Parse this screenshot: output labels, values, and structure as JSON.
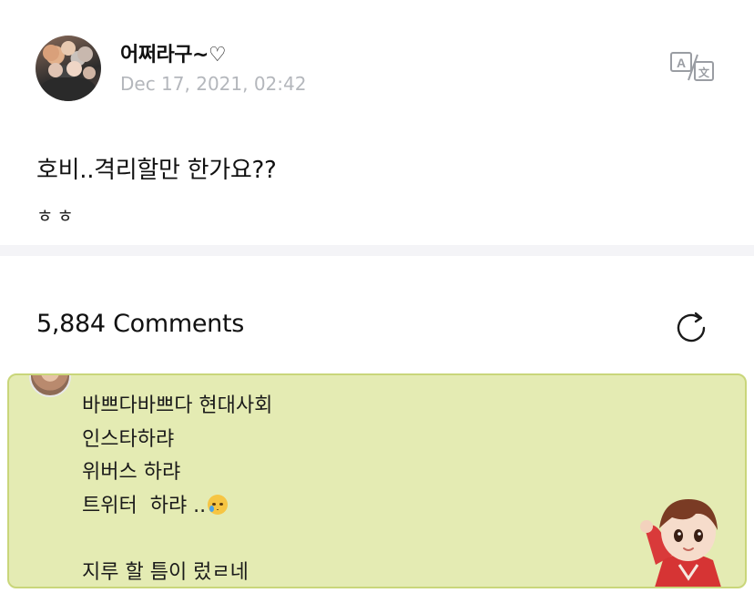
{
  "post": {
    "author": "어쩌라구~♡",
    "date": "Dec 17, 2021, 02:42",
    "title": "호비..격리할만 한가요??",
    "subtitle": "ㅎㅎ"
  },
  "comments": {
    "count_label": "5,884 Comments"
  },
  "comment": {
    "lines": [
      "바쁘다바쁘다 현대사회",
      "인스타하랴",
      "위버스 하랴",
      "트위터  하랴 ..",
      "",
      "지루 할 틈이 렀ㄹ네"
    ],
    "emoji": "crying-face-emoji",
    "sticker": "character-sticker"
  },
  "icons": {
    "translate": "translate-icon",
    "refresh": "refresh-icon"
  },
  "colors": {
    "card_background": "#e4ebb3",
    "card_border": "#c9d67a",
    "date_text": "#b4b7bc",
    "divider": "#f4f4f7"
  }
}
